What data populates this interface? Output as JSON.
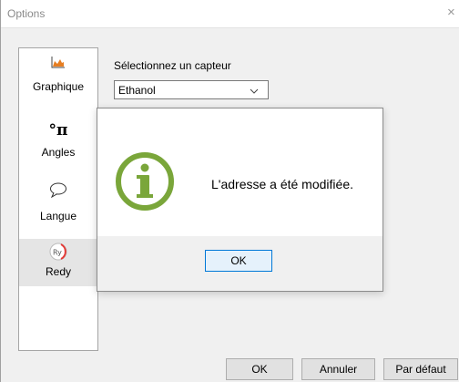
{
  "window": {
    "title": "Options",
    "close_glyph": "×"
  },
  "sidebar": {
    "items": [
      {
        "label": "Graphique",
        "icon": "chart-icon"
      },
      {
        "label": "Angles",
        "icon": "degree-pi-icon",
        "icon_text": "°π"
      },
      {
        "label": "Langue",
        "icon": "speech-bubble-icon"
      },
      {
        "label": "Redy",
        "icon": "redy-logo-icon",
        "icon_text": "Ry",
        "selected": true
      }
    ]
  },
  "sensor": {
    "label": "Sélectionnez un capteur",
    "selected": "Ethanol"
  },
  "footer": {
    "ok_label": "OK",
    "cancel_label": "Annuler",
    "default_label": "Par défaut"
  },
  "dialog": {
    "message": "L'adresse a été modifiée.",
    "ok_label": "OK",
    "icon": "info-icon",
    "icon_color": "#7aa63a"
  },
  "colors": {
    "accent": "#0078d7",
    "chart_icon": "#e67e22",
    "redy_logo": "#e53935"
  }
}
